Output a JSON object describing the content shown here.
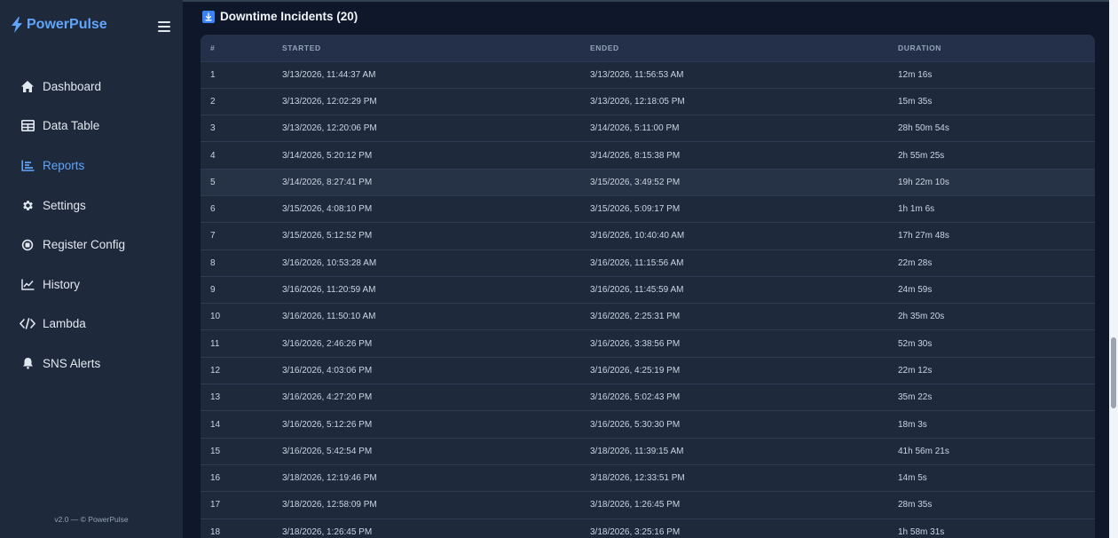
{
  "brand": {
    "name": "PowerPulse",
    "color": "#60a5fa"
  },
  "sidebar": {
    "items": [
      {
        "label": "Dashboard",
        "icon": "home-icon",
        "active": false
      },
      {
        "label": "Data Table",
        "icon": "table-icon",
        "active": false
      },
      {
        "label": "Reports",
        "icon": "reports-icon",
        "active": true
      },
      {
        "label": "Settings",
        "icon": "gear-icon",
        "active": false
      },
      {
        "label": "Register Config",
        "icon": "chip-icon",
        "active": false
      },
      {
        "label": "History",
        "icon": "line-chart-icon",
        "active": false
      },
      {
        "label": "Lambda",
        "icon": "code-icon",
        "active": false
      },
      {
        "label": "SNS Alerts",
        "icon": "bell-icon",
        "active": false
      }
    ],
    "footer": "v2.0 — © PowerPulse"
  },
  "section": {
    "title": "Downtime Incidents (20)",
    "icon": "download-icon"
  },
  "table": {
    "columns": [
      "#",
      "Started",
      "Ended",
      "Duration"
    ],
    "rows": [
      [
        "1",
        "3/13/2026, 11:44:37 AM",
        "3/13/2026, 11:56:53 AM",
        "12m 16s"
      ],
      [
        "2",
        "3/13/2026, 12:02:29 PM",
        "3/13/2026, 12:18:05 PM",
        "15m 35s"
      ],
      [
        "3",
        "3/13/2026, 12:20:06 PM",
        "3/14/2026, 5:11:00 PM",
        "28h 50m 54s"
      ],
      [
        "4",
        "3/14/2026, 5:20:12 PM",
        "3/14/2026, 8:15:38 PM",
        "2h 55m 25s"
      ],
      [
        "5",
        "3/14/2026, 8:27:41 PM",
        "3/15/2026, 3:49:52 PM",
        "19h 22m 10s"
      ],
      [
        "6",
        "3/15/2026, 4:08:10 PM",
        "3/15/2026, 5:09:17 PM",
        "1h 1m 6s"
      ],
      [
        "7",
        "3/15/2026, 5:12:52 PM",
        "3/16/2026, 10:40:40 AM",
        "17h 27m 48s"
      ],
      [
        "8",
        "3/16/2026, 10:53:28 AM",
        "3/16/2026, 11:15:56 AM",
        "22m 28s"
      ],
      [
        "9",
        "3/16/2026, 11:20:59 AM",
        "3/16/2026, 11:45:59 AM",
        "24m 59s"
      ],
      [
        "10",
        "3/16/2026, 11:50:10 AM",
        "3/16/2026, 2:25:31 PM",
        "2h 35m 20s"
      ],
      [
        "11",
        "3/16/2026, 2:46:26 PM",
        "3/16/2026, 3:38:56 PM",
        "52m 30s"
      ],
      [
        "12",
        "3/16/2026, 4:03:06 PM",
        "3/16/2026, 4:25:19 PM",
        "22m 12s"
      ],
      [
        "13",
        "3/16/2026, 4:27:20 PM",
        "3/16/2026, 5:02:43 PM",
        "35m 22s"
      ],
      [
        "14",
        "3/16/2026, 5:12:26 PM",
        "3/16/2026, 5:30:30 PM",
        "18m 3s"
      ],
      [
        "15",
        "3/16/2026, 5:42:54 PM",
        "3/18/2026, 11:39:15 AM",
        "41h 56m 21s"
      ],
      [
        "16",
        "3/18/2026, 12:19:46 PM",
        "3/18/2026, 12:33:51 PM",
        "14m 5s"
      ],
      [
        "17",
        "3/18/2026, 12:58:09 PM",
        "3/18/2026, 1:26:45 PM",
        "28m 35s"
      ],
      [
        "18",
        "3/18/2026, 1:26:45 PM",
        "3/18/2026, 3:25:16 PM",
        "1h 58m 31s"
      ]
    ],
    "highlighted_row": 5
  },
  "colors": {
    "sidebar_bg": "#1e293b",
    "main_bg": "#0f172a",
    "accent": "#60a5fa"
  }
}
